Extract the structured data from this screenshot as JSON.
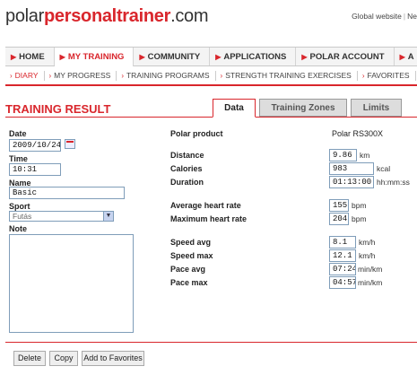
{
  "header": {
    "logo_part1": "polar",
    "logo_part2": "personaltrainer",
    "logo_part3": ".com",
    "toplinks": [
      "Global website",
      "Ne"
    ]
  },
  "main_nav": [
    {
      "label": "HOME"
    },
    {
      "label": "MY TRAINING",
      "active": true
    },
    {
      "label": "COMMUNITY"
    },
    {
      "label": "APPLICATIONS"
    },
    {
      "label": "POLAR ACCOUNT"
    },
    {
      "label": "A"
    }
  ],
  "sub_nav": [
    {
      "label": "DIARY",
      "active": true
    },
    {
      "label": "MY PROGRESS"
    },
    {
      "label": "TRAINING PROGRAMS"
    },
    {
      "label": "STRENGTH TRAINING EXERCISES"
    },
    {
      "label": "FAVORITES"
    }
  ],
  "page": {
    "title": "TRAINING RESULT",
    "tabs": [
      "Data",
      "Training Zones",
      "Limits"
    ]
  },
  "form": {
    "date_label": "Date",
    "date_value": "2009/10/24",
    "time_label": "Time",
    "time_value": "10:31",
    "name_label": "Name",
    "name_value": "Basic",
    "sport_label": "Sport",
    "sport_value": "Futás",
    "note_label": "Note",
    "note_value": ""
  },
  "result": {
    "product_label": "Polar product",
    "product_value": "Polar RS300X",
    "distance_label": "Distance",
    "distance_value": "9.86",
    "distance_unit": "km",
    "calories_label": "Calories",
    "calories_value": "983",
    "calories_unit": "kcal",
    "duration_label": "Duration",
    "duration_value": "01:13:00",
    "duration_unit": "hh:mm:ss",
    "avg_hr_label": "Average heart rate",
    "avg_hr_value": "155",
    "avg_hr_unit": "bpm",
    "max_hr_label": "Maximum heart rate",
    "max_hr_value": "204",
    "max_hr_unit": "bpm",
    "speed_avg_label": "Speed avg",
    "speed_avg_value": "8.1",
    "speed_avg_unit": "km/h",
    "speed_max_label": "Speed max",
    "speed_max_value": "12.1",
    "speed_max_unit": "km/h",
    "pace_avg_label": "Pace avg",
    "pace_avg_value": "07:24",
    "pace_avg_unit": "min/km",
    "pace_max_label": "Pace max",
    "pace_max_value": "04:57",
    "pace_max_unit": "min/km"
  },
  "buttons": {
    "delete": "Delete",
    "copy": "Copy",
    "favorites": "Add to Favorites"
  },
  "colors": {
    "brand_red": "#d9262c"
  }
}
